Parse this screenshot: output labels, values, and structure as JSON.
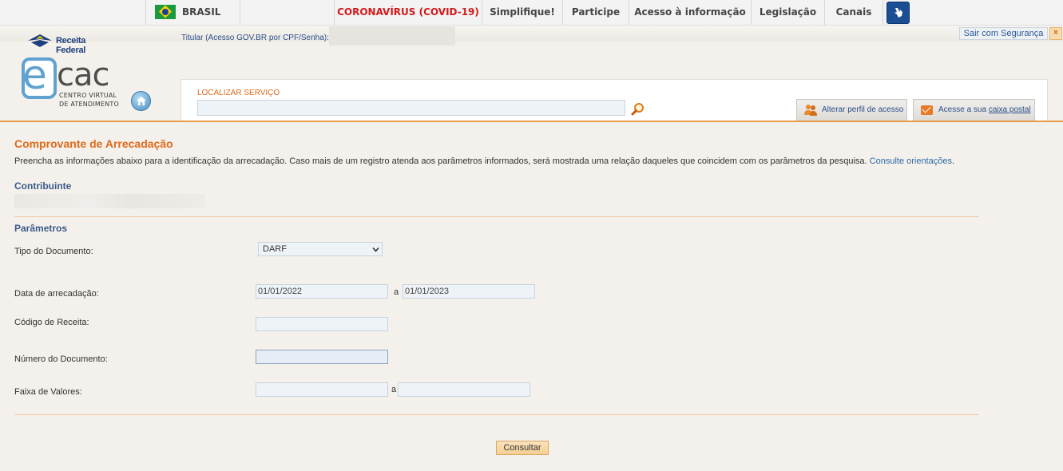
{
  "gov_bar": {
    "brasil": "BRASIL",
    "covid": "CORONAVÍRUS (COVID-19)",
    "simplifique": "Simplifique!",
    "participe": "Participe",
    "acesso_info": "Acesso à informação",
    "legislacao": "Legislação",
    "canais": "Canais",
    "accent_red": "#d1191b"
  },
  "header": {
    "receita_logo": "Receita Federal",
    "titular": "Titular (Acesso GOV.BR por CPF/Senha):",
    "sair": "Sair com Segurança",
    "close": "×",
    "ecac_line1": "CENTRO VIRTUAL",
    "ecac_line2": "DE ATENDIMENTO",
    "ecac_cac": "cac",
    "ecac_e": "e"
  },
  "search": {
    "label": "LOCALIZAR SERVIÇO",
    "value": "",
    "alterar_perfil": "Alterar perfil de acesso",
    "caixa_prefix": "Acesse a sua ",
    "caixa_link": "caixa postal"
  },
  "page": {
    "title": "Comprovante de Arrecadação",
    "instructions": "Preencha as informações abaixo para a identificação da arrecadação. Caso mais de um registro atenda aos parâmetros informados, será mostrada uma relação daqueles que coincidem com os parâmetros da pesquisa. ",
    "instructions_link": "Consulte orientações",
    "instructions_end": ".",
    "contribuinte_head": "Contribuinte",
    "parametros_head": "Parâmetros"
  },
  "form": {
    "tipo_label": "Tipo do Documento:",
    "tipo_value": "DARF",
    "data_label": "Data de arrecadação:",
    "data_from": "01/01/2022",
    "data_to": "01/01/2023",
    "data_sep": "a",
    "codigo_label": "Código de Receita:",
    "codigo_value": "",
    "numero_label": "Número do Documento:",
    "numero_value": "",
    "faixa_label": "Faixa de Valores:",
    "faixa_from": "",
    "faixa_to": "",
    "faixa_sep": "a",
    "submit": "Consultar"
  }
}
